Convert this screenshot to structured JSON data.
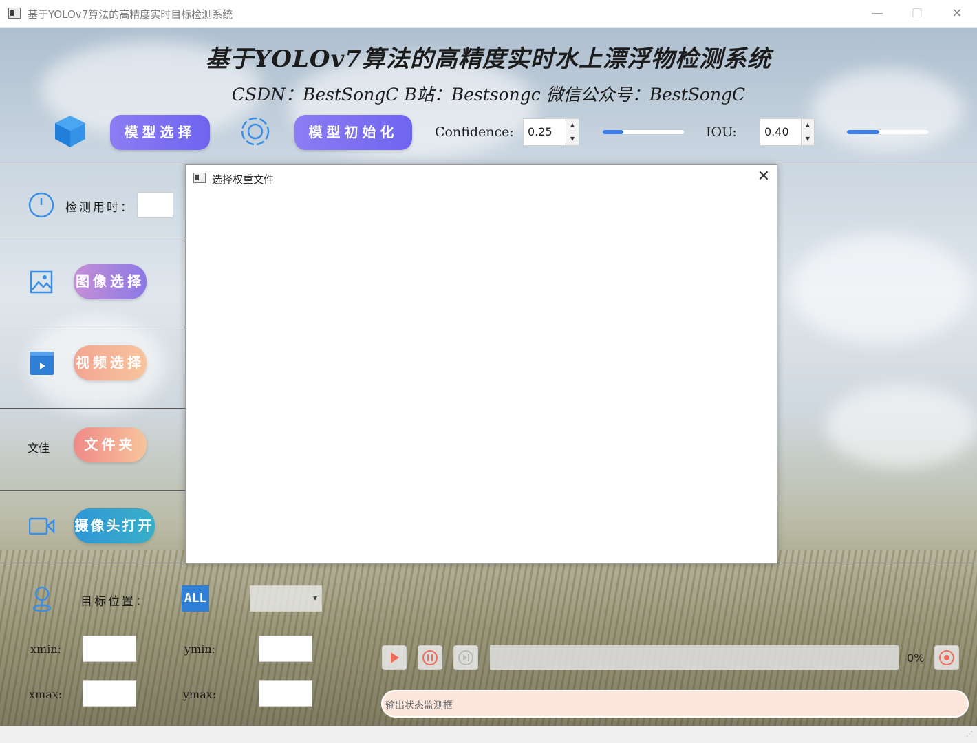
{
  "window": {
    "title": "基于YOLOv7算法的高精度实时目标检测系统",
    "minimize": "—",
    "maximize": "☐",
    "close": "✕"
  },
  "header": {
    "title": "基于YOLOv7算法的高精度实时水上漂浮物检测系统",
    "subtitle": "CSDN：BestSongC   B站：Bestsongc   微信公众号：BestSongC"
  },
  "toolbar": {
    "model_select": "模型选择",
    "model_init": "模型初始化",
    "confidence_label": "Confidence:",
    "confidence_value": "0.25",
    "confidence_level": 0.25,
    "iou_label": "IOU:",
    "iou_value": "0.40",
    "iou_level": 0.4
  },
  "sidebar": {
    "time_label": "检测用时：",
    "image_select": "图像选择",
    "video_select": "视频选择",
    "folder_label": "文佳",
    "folder_button": "文件夹",
    "camera_open": "摄像头打开"
  },
  "target": {
    "label": "目标位置：",
    "all_badge": "ALL",
    "xmin_label": "xmin:",
    "ymin_label": "ymin:",
    "xmax_label": "xmax:",
    "ymax_label": "ymax:"
  },
  "player": {
    "percent": "0%",
    "status_placeholder": "输出状态监测框"
  },
  "dialog": {
    "title": "选择权重文件",
    "close": "✕"
  },
  "colors": {
    "accent_purple": "#7b6ff1",
    "slider_blue": "#3e7ee8",
    "status_bg": "#fde6dc",
    "all_badge": "#2f7fd6"
  }
}
